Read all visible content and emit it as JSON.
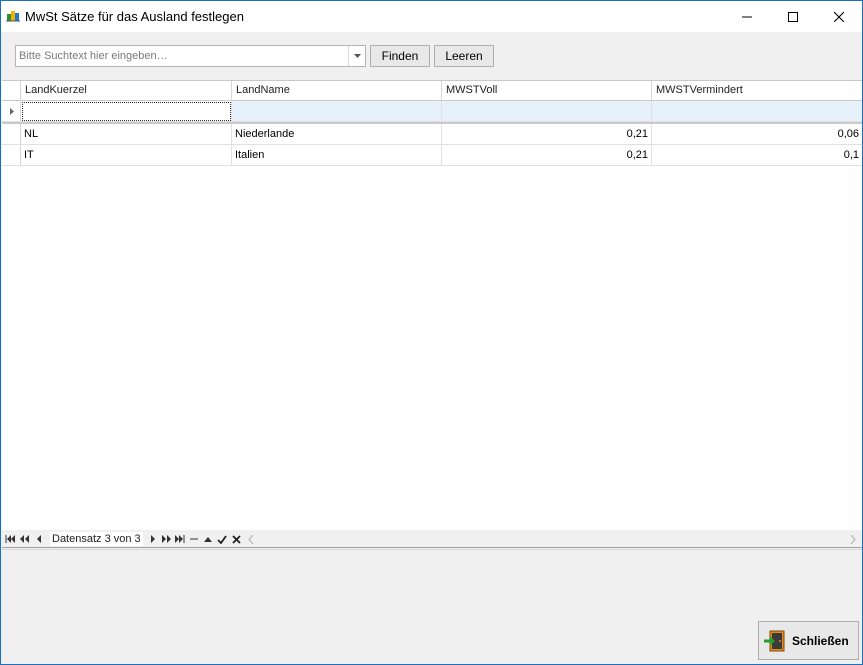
{
  "window": {
    "title": "MwSt Sätze für das Ausland festlegen"
  },
  "toolbar": {
    "search_placeholder": "Bitte Suchtext hier eingeben…",
    "find_label": "Finden",
    "clear_label": "Leeren"
  },
  "grid": {
    "columns": [
      "LandKuerzel",
      "LandName",
      "MWSTVoll",
      "MWSTVermindert"
    ],
    "rows": [
      [
        "NL",
        "Niederlande",
        "0,21",
        "0,06"
      ],
      [
        "IT",
        "Italien",
        "0,21",
        "0,1"
      ]
    ]
  },
  "navigator": {
    "record_label": "Datensatz 3 von 3"
  },
  "footer": {
    "close_label": "Schließen"
  }
}
